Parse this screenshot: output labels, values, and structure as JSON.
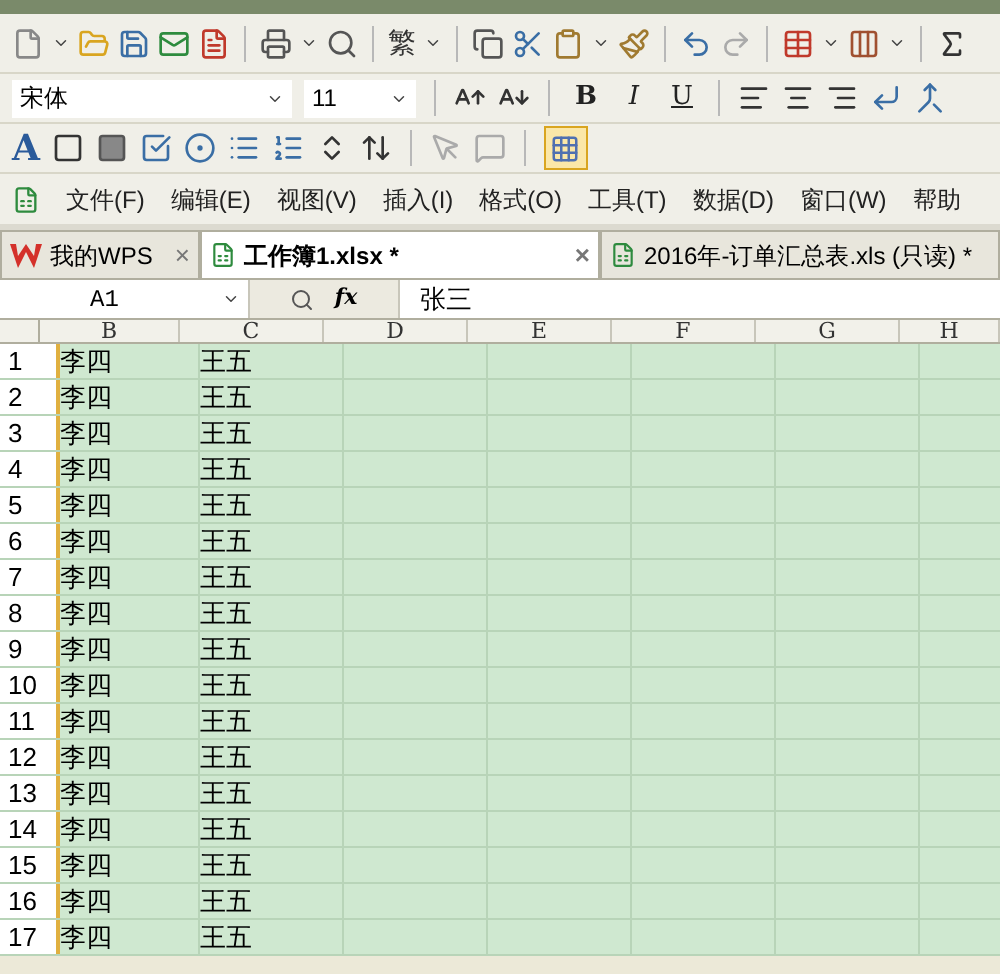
{
  "toolbar": {
    "traditional_button": "繁"
  },
  "format_bar": {
    "font": "宋体",
    "size": "11",
    "style_buttons": [
      {
        "label": "B",
        "kind": "bold"
      },
      {
        "label": "I",
        "kind": "italic"
      },
      {
        "label": "U",
        "kind": "underline"
      }
    ]
  },
  "controls_bar": {
    "wordart": "A"
  },
  "menu": [
    "文件(F)",
    "编辑(E)",
    "视图(V)",
    "插入(I)",
    "格式(O)",
    "工具(T)",
    "数据(D)",
    "窗口(W)",
    "帮助"
  ],
  "tabs": [
    {
      "label": "我的WPS",
      "kind": "home",
      "selected": false,
      "close": "×"
    },
    {
      "label": "工作簿1.xlsx *",
      "kind": "sheet",
      "selected": true,
      "close": "×"
    },
    {
      "label": "2016年-订单汇总表.xls (只读) *",
      "kind": "sheet",
      "selected": false
    }
  ],
  "formula_bar": {
    "cell": "A1",
    "fx": "fx",
    "value": "张三"
  },
  "columns": [
    "B",
    "C",
    "D",
    "E",
    "F",
    "G",
    "H"
  ],
  "rows": [
    {
      "n": "1",
      "cells": [
        "李四",
        "王五"
      ]
    },
    {
      "n": "2",
      "cells": [
        "李四",
        "王五"
      ]
    },
    {
      "n": "3",
      "cells": [
        "李四",
        "王五"
      ]
    },
    {
      "n": "4",
      "cells": [
        "李四",
        "王五"
      ]
    },
    {
      "n": "5",
      "cells": [
        "李四",
        "王五"
      ]
    },
    {
      "n": "6",
      "cells": [
        "李四",
        "王五"
      ]
    },
    {
      "n": "7",
      "cells": [
        "李四",
        "王五"
      ]
    },
    {
      "n": "8",
      "cells": [
        "李四",
        "王五"
      ]
    },
    {
      "n": "9",
      "cells": [
        "李四",
        "王五"
      ]
    },
    {
      "n": "10",
      "cells": [
        "李四",
        "王五"
      ]
    },
    {
      "n": "11",
      "cells": [
        "李四",
        "王五"
      ]
    },
    {
      "n": "12",
      "cells": [
        "李四",
        "王五"
      ]
    },
    {
      "n": "13",
      "cells": [
        "李四",
        "王五"
      ]
    },
    {
      "n": "14",
      "cells": [
        "李四",
        "王五"
      ]
    },
    {
      "n": "15",
      "cells": [
        "李四",
        "王五"
      ]
    },
    {
      "n": "16",
      "cells": [
        "李四",
        "王五"
      ]
    },
    {
      "n": "17",
      "cells": [
        "李四",
        "王五"
      ]
    }
  ]
}
